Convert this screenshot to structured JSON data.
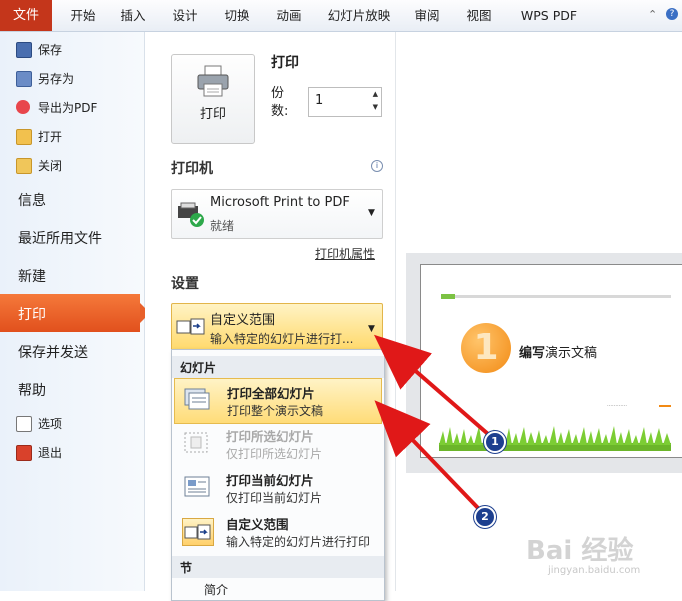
{
  "ribbon": {
    "file_tab": "文件",
    "tabs": [
      "开始",
      "插入",
      "设计",
      "切换",
      "动画",
      "幻灯片放映",
      "审阅",
      "视图",
      "WPS PDF"
    ]
  },
  "nav": {
    "save": "保存",
    "save_as": "另存为",
    "export_pdf": "导出为PDF",
    "open": "打开",
    "close": "关闭",
    "info": "信息",
    "recent": "最近所用文件",
    "new": "新建",
    "print": "打印",
    "save_send": "保存并发送",
    "help": "帮助",
    "options": "选项",
    "exit": "退出"
  },
  "print": {
    "button_label": "打印",
    "heading": "打印",
    "copies_label": "份数:",
    "copies_value": "1"
  },
  "printer": {
    "heading": "打印机",
    "name": "Microsoft Print to PDF",
    "status": "就绪",
    "properties_link": "打印机属性"
  },
  "settings": {
    "heading": "设置",
    "range_title": "自定义范围",
    "range_sub": "输入特定的幻灯片进行打..."
  },
  "menu": {
    "header_slides": "幻灯片",
    "items": [
      {
        "title": "打印全部幻灯片",
        "sub": "打印整个演示文稿"
      },
      {
        "title": "打印所选幻灯片",
        "sub": "仅打印所选幻灯片"
      },
      {
        "title": "打印当前幻灯片",
        "sub": "仅打印当前幻灯片"
      },
      {
        "title": "自定义范围",
        "sub": "输入特定的幻灯片进行打印"
      }
    ],
    "header_section": "节",
    "partial_item": "简介"
  },
  "preview": {
    "number": "1",
    "title_bold": "编写",
    "title_rest": "演示文稿",
    "small_text": "…………"
  },
  "annotations": {
    "marker1": "1",
    "marker2": "2"
  },
  "watermark": {
    "main": "Bai 经验",
    "sub": "jingyan.baidu.com"
  },
  "colors": {
    "file_tab": "#c4361b",
    "selected_nav": "#e8602a",
    "highlight": "#ffdc78",
    "arrow": "#e01818"
  }
}
